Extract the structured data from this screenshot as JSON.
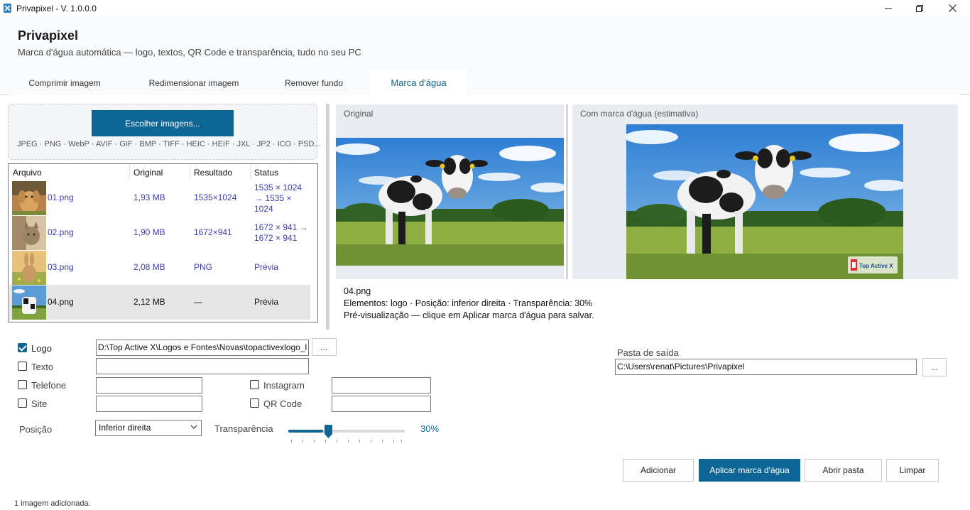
{
  "window": {
    "title": "Privapixel - V. 1.0.0.0"
  },
  "header": {
    "app_name": "Privapixel",
    "subtitle": "Marca d'água automática — logo, textos, QR Code e transparência, tudo no seu PC"
  },
  "tabs": [
    {
      "label": "Comprimir imagem",
      "active": false
    },
    {
      "label": "Redimensionar imagem",
      "active": false
    },
    {
      "label": "Remover fundo",
      "active": false
    },
    {
      "label": "Marca d'água",
      "active": true
    }
  ],
  "dropzone": {
    "button_label": "Escolher imagens...",
    "formats": "JPEG · PNG · WebP · AVIF · GIF · BMP · TIFF · HEIC · HEIF · JXL · JP2 · ICO · PSD..."
  },
  "file_table": {
    "columns": [
      "Arquivo",
      "Original",
      "Resultado",
      "Status"
    ],
    "rows": [
      {
        "name": "01.png",
        "original": "1,93 MB",
        "result": "1535×1024",
        "status": "1535 × 1024 → 1535 × 1024",
        "thumb": "dog-photo"
      },
      {
        "name": "02.png",
        "original": "1,90 MB",
        "result": "1672×941",
        "status": "1672 × 941 → 1672 × 941",
        "thumb": "cat-photo"
      },
      {
        "name": "03.png",
        "original": "2,08 MB",
        "result": "PNG",
        "status": "Prévia",
        "thumb": "rabbit-photo"
      },
      {
        "name": "04.png",
        "original": "2,12 MB",
        "result": "—",
        "status": "Prévia",
        "thumb": "cow-photo",
        "selected": true
      }
    ]
  },
  "preview": {
    "original_label": "Original",
    "watermark_label": "Com marca d'água (estimativa)",
    "watermark_logo_text": "Top Active X",
    "info": {
      "filename": "04.png",
      "details": "Elementos: logo · Posição: inferior direita · Transparência: 30%",
      "hint": "Pré-visualização — clique em Aplicar marca d'água para salvar."
    }
  },
  "options": {
    "logo": {
      "label": "Logo",
      "checked": true,
      "value": "D:\\Top Active X\\Logos e Fontes\\Novas\\topactivexlogo_l",
      "browse": "..."
    },
    "text": {
      "label": "Texto",
      "checked": false,
      "value": ""
    },
    "phone": {
      "label": "Telefone",
      "checked": false,
      "value": ""
    },
    "site": {
      "label": "Site",
      "checked": false,
      "value": ""
    },
    "instagram": {
      "label": "Instagram",
      "checked": false,
      "value": ""
    },
    "qrcode": {
      "label": "QR Code",
      "checked": false,
      "value": ""
    },
    "position": {
      "label": "Posição",
      "value": "Inferior direita"
    },
    "transparency": {
      "label": "Transparência",
      "value": "30%",
      "fraction": 0.3
    }
  },
  "output": {
    "label": "Pasta de saída",
    "path": "C:\\Users\\renat\\Pictures\\Privapixel",
    "browse": "..."
  },
  "actions": {
    "add": "Adicionar",
    "apply": "Aplicar marca d'água",
    "open_folder": "Abrir pasta",
    "clear": "Limpar"
  },
  "status": "1 imagem adicionada.",
  "colors": {
    "accent": "#0e6697",
    "link_text": "#3b3bbf"
  }
}
